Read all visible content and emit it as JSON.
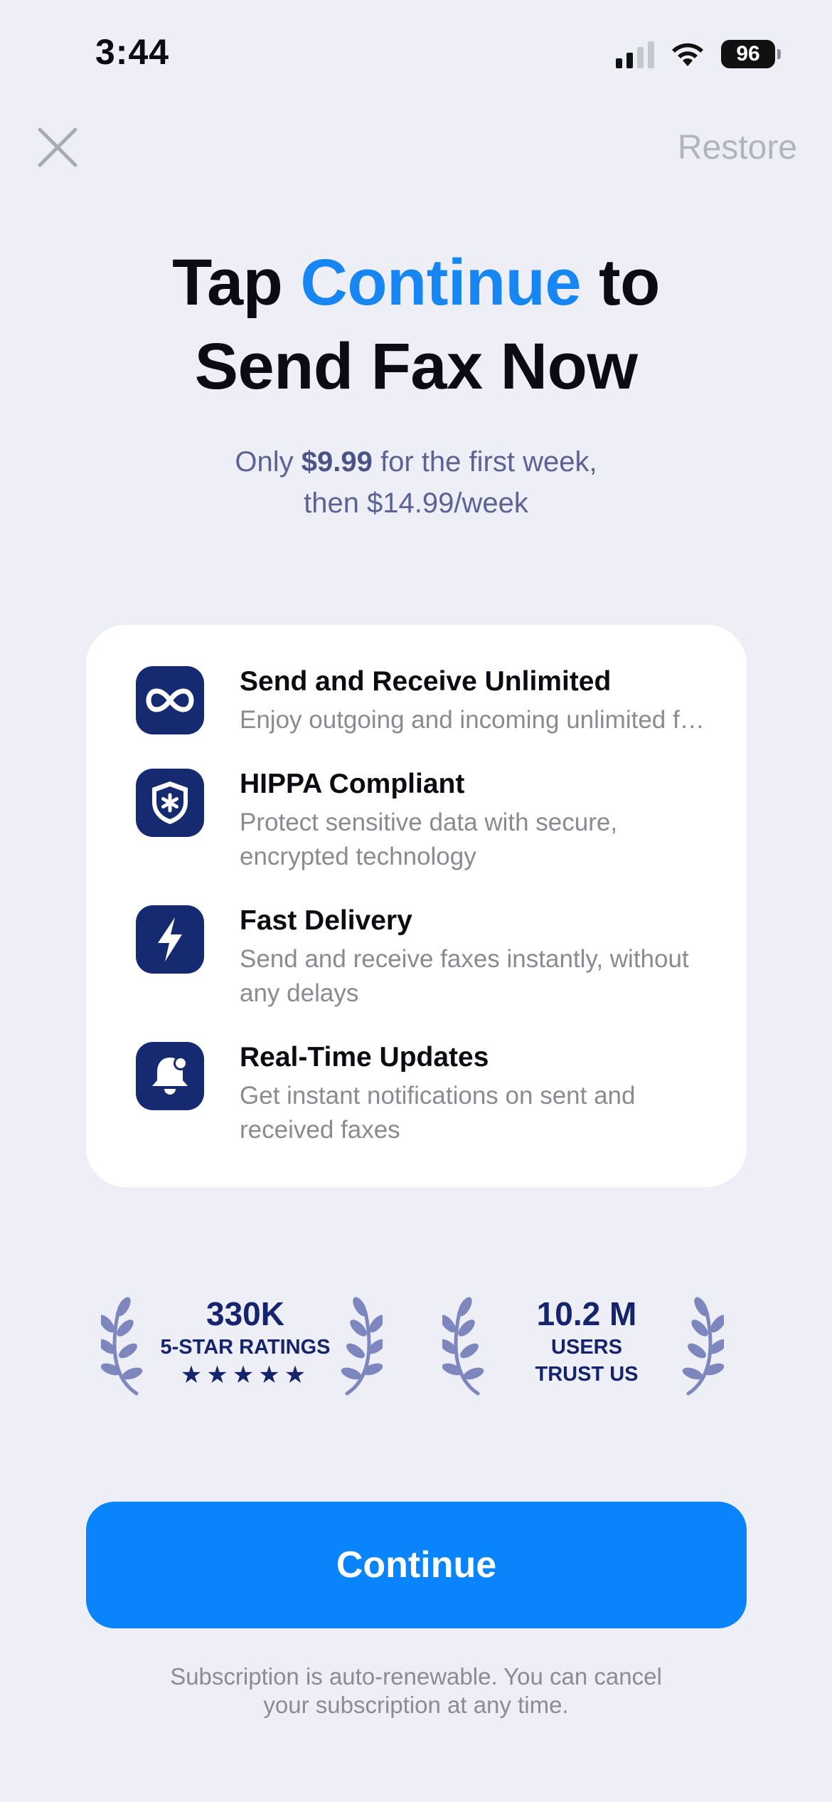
{
  "status_bar": {
    "time": "3:44",
    "battery": "96"
  },
  "header": {
    "close_icon": "close-icon",
    "restore_label": "Restore"
  },
  "headline": {
    "part1": "Tap ",
    "accent": "Continue",
    "part2": " to",
    "line2": "Send Fax Now",
    "accent_color": "#1786f2"
  },
  "pricing": {
    "prefix": "Only ",
    "intro_price": "$9.99",
    "suffix": " for the first week,",
    "line2": "then $14.99/week"
  },
  "features": [
    {
      "icon": "infinity-icon",
      "title": "Send and Receive Unlimited",
      "description": "Enjoy outgoing and incoming unlimited faxes"
    },
    {
      "icon": "shield-icon",
      "title": "HIPPA Compliant",
      "description": "Protect sensitive data with secure, encrypted technology"
    },
    {
      "icon": "lightning-icon",
      "title": "Fast Delivery",
      "description": "Send and receive faxes instantly, without any delays"
    },
    {
      "icon": "bell-icon",
      "title": "Real-Time Updates",
      "description": "Get instant notifications on sent and received faxes"
    }
  ],
  "stats": {
    "ratings_value": "330K",
    "ratings_label": "5-STAR RATINGS",
    "ratings_stars": "★★★★★",
    "users_value": "10.2 M",
    "users_label_line1": "USERS",
    "users_label_line2": "TRUST US"
  },
  "cta": {
    "continue_label": "Continue",
    "color": "#0a84fb"
  },
  "footnote": {
    "line1": "Subscription is auto-renewable. You can cancel",
    "line2": "your subscription at any time."
  }
}
